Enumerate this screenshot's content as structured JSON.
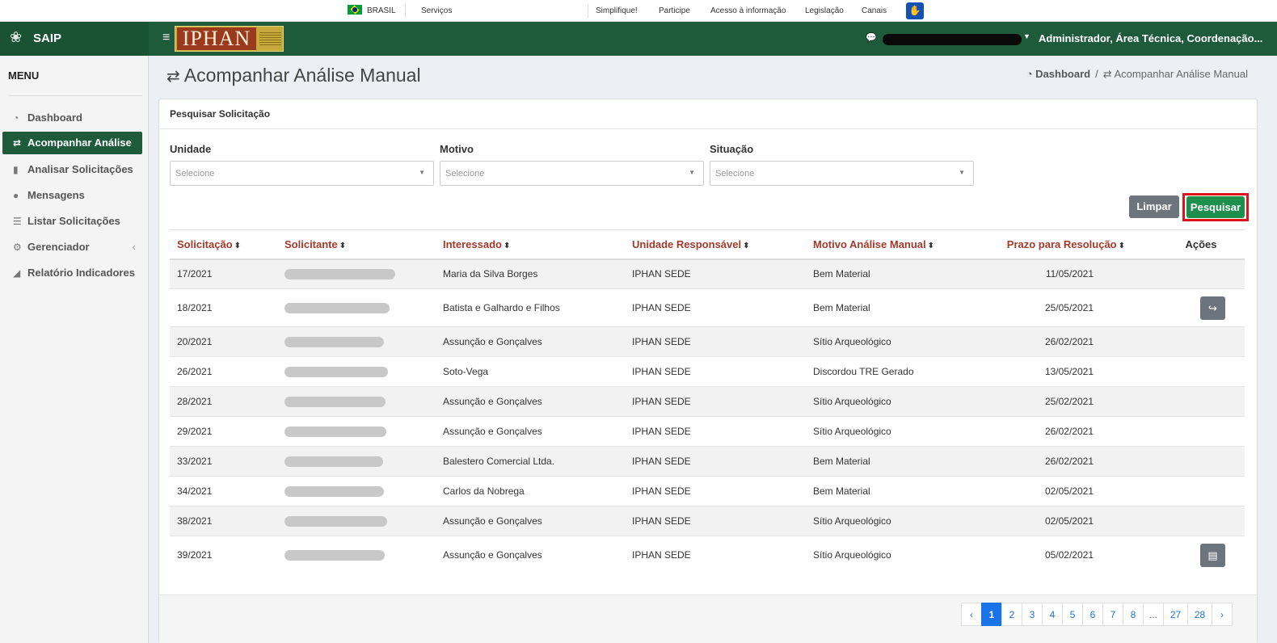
{
  "govbar": {
    "country": "BRASIL",
    "servicos": "Serviços",
    "links": [
      "Simplifique!",
      "Participe",
      "Acesso à informação",
      "Legislação",
      "Canais"
    ]
  },
  "header": {
    "app_name": "SAIP",
    "logo_text": "IPHAN",
    "user_role": "Administrador, Área Técnica, Coordenação..."
  },
  "sidebar": {
    "title": "MENU",
    "items": [
      {
        "label": "Dashboard",
        "icon": "tachometer-icon"
      },
      {
        "label": "Acompanhar Análise",
        "icon": "exchange-icon",
        "active": true
      },
      {
        "label": "Analisar Solicitações",
        "icon": "book-icon"
      },
      {
        "label": "Mensagens",
        "icon": "comments-icon"
      },
      {
        "label": "Listar Solicitações",
        "icon": "list-icon"
      },
      {
        "label": "Gerenciador",
        "icon": "cogs-icon",
        "has_submenu": true
      },
      {
        "label": "Relatório Indicadores",
        "icon": "area-chart-icon"
      }
    ]
  },
  "page": {
    "title": "Acompanhar Análise Manual",
    "breadcrumb": [
      "Dashboard",
      "Acompanhar Análise Manual"
    ]
  },
  "search": {
    "panel_title": "Pesquisar Solicitação",
    "fields": [
      {
        "label": "Unidade",
        "placeholder": "Selecione"
      },
      {
        "label": "Motivo",
        "placeholder": "Selecione"
      },
      {
        "label": "Situação",
        "placeholder": "Selecione"
      }
    ],
    "clear_label": "Limpar",
    "search_label": "Pesquisar"
  },
  "table": {
    "columns": [
      "Solicitação",
      "Solicitante",
      "Interessado",
      "Unidade Responsável",
      "Motivo Análise Manual",
      "Prazo para Resolução",
      "Ações"
    ],
    "rows": [
      {
        "solicitacao": "17/2021",
        "interessado": "Maria da Silva Borges",
        "unidade": "IPHAN SEDE",
        "motivo": "Bem Material",
        "prazo": "11/05/2021",
        "acao": ""
      },
      {
        "solicitacao": "18/2021",
        "interessado": "Batista e Galhardo e Filhos",
        "unidade": "IPHAN SEDE",
        "motivo": "Bem Material",
        "prazo": "25/05/2021",
        "acao": "share-icon"
      },
      {
        "solicitacao": "20/2021",
        "interessado": "Assunção e Gonçalves",
        "unidade": "IPHAN SEDE",
        "motivo": "Sítio Arqueológico",
        "prazo": "26/02/2021",
        "acao": ""
      },
      {
        "solicitacao": "26/2021",
        "interessado": "Soto-Vega",
        "unidade": "IPHAN SEDE",
        "motivo": "Discordou TRE Gerado",
        "prazo": "13/05/2021",
        "acao": ""
      },
      {
        "solicitacao": "28/2021",
        "interessado": "Assunção e Gonçalves",
        "unidade": "IPHAN SEDE",
        "motivo": "Sítio Arqueológico",
        "prazo": "25/02/2021",
        "acao": ""
      },
      {
        "solicitacao": "29/2021",
        "interessado": "Assunção e Gonçalves",
        "unidade": "IPHAN SEDE",
        "motivo": "Sítio Arqueológico",
        "prazo": "26/02/2021",
        "acao": ""
      },
      {
        "solicitacao": "33/2021",
        "interessado": "Balestero Comercial Ltda.",
        "unidade": "IPHAN SEDE",
        "motivo": "Bem Material",
        "prazo": "26/02/2021",
        "acao": ""
      },
      {
        "solicitacao": "34/2021",
        "interessado": "Carlos da Nobrega",
        "unidade": "IPHAN SEDE",
        "motivo": "Bem Material",
        "prazo": "02/05/2021",
        "acao": ""
      },
      {
        "solicitacao": "38/2021",
        "interessado": "Assunção e Gonçalves",
        "unidade": "IPHAN SEDE",
        "motivo": "Sítio Arqueológico",
        "prazo": "02/05/2021",
        "acao": ""
      },
      {
        "solicitacao": "39/2021",
        "interessado": "Assunção e Gonçalves",
        "unidade": "IPHAN SEDE",
        "motivo": "Sítio Arqueológico",
        "prazo": "05/02/2021",
        "acao": "document-icon"
      }
    ]
  },
  "pagination": {
    "prev": "‹",
    "pages": [
      "1",
      "2",
      "3",
      "4",
      "5",
      "6",
      "7",
      "8",
      "...",
      "27",
      "28"
    ],
    "current": "1",
    "next": "›"
  },
  "colors": {
    "header_green": "#1e5b3b",
    "active_menu": "#1e5b3b",
    "column_header_red": "#a33a2a",
    "search_button": "#1f8f4e",
    "highlight_border": "#e0121b",
    "pager_active": "#1a73e8"
  }
}
